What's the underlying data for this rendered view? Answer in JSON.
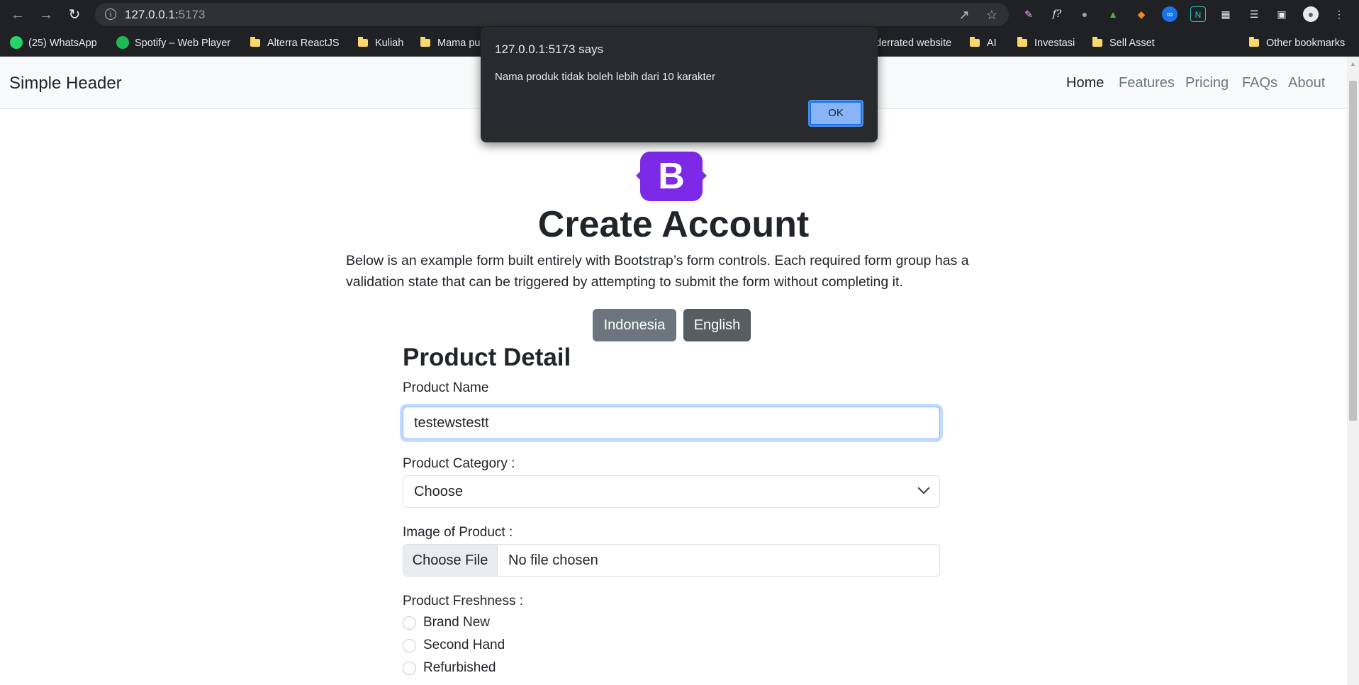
{
  "browser": {
    "url_host": "127.0.0.1:",
    "url_port": "5173",
    "bookmarks": [
      {
        "label": "(25) WhatsApp",
        "type": "whatsapp"
      },
      {
        "label": "Spotify – Web Player",
        "type": "spotify"
      },
      {
        "label": "Alterra ReactJS",
        "type": "folder"
      },
      {
        "label": "Kuliah",
        "type": "folder"
      },
      {
        "label": "Mama pu",
        "type": "folder"
      },
      {
        "label": "derrated website",
        "type": "folder"
      },
      {
        "label": "AI",
        "type": "folder"
      },
      {
        "label": "Investasi",
        "type": "folder"
      },
      {
        "label": "Sell Asset",
        "type": "folder"
      },
      {
        "label": "Other bookmarks",
        "type": "folder"
      }
    ]
  },
  "header": {
    "brand": "Simple Header",
    "nav": [
      "Home",
      "Features",
      "Pricing",
      "FAQs",
      "About"
    ]
  },
  "hero": {
    "logo_letter": "B",
    "title": "Create Account",
    "lead_line1": "Below is an example form built entirely with Bootstrap’s form controls. Each required form group has a",
    "lead_line2": "validation state that can be triggered by attempting to submit the form without completing it.",
    "btn_indonesia": "Indonesia",
    "btn_english": "English"
  },
  "form": {
    "section_title": "Product Detail",
    "product_name_label": "Product Name",
    "product_name_value": "testewstestt",
    "category_label": "Product Category :",
    "category_value": "Choose",
    "image_label": "Image of Product :",
    "file_button": "Choose File",
    "file_status": "No file chosen",
    "freshness_label": "Product Freshness :",
    "freshness_options": [
      "Brand New",
      "Second Hand",
      "Refurbished"
    ]
  },
  "dialog": {
    "title": "127.0.0.1:5173 says",
    "message": "Nama produk tidak boleh lebih dari 10 karakter",
    "ok_label": "OK"
  },
  "colors": {
    "bootstrap_purple": "#7d2ae8",
    "secondary_btn": "#6c757d",
    "dark_btn": "#565e64",
    "focus_border": "#86b7fe",
    "dialog_bg": "#292a2d",
    "ok_btn": "#8ab4f8"
  }
}
